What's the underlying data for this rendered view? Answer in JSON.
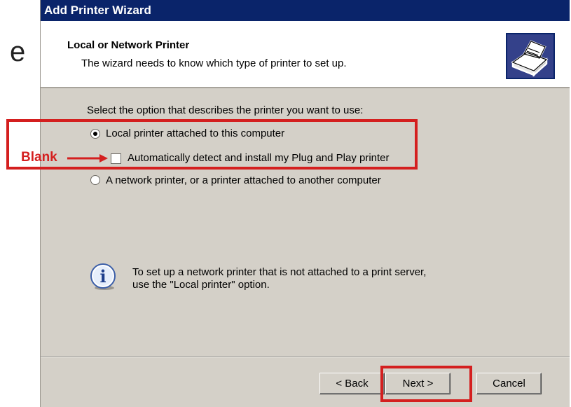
{
  "background_fragment": "e",
  "window": {
    "title": "Add Printer Wizard"
  },
  "header": {
    "title": "Local or Network Printer",
    "subtitle": "The wizard needs to know which type of printer to set up."
  },
  "content": {
    "prompt": "Select the option that describes the printer you want to use:",
    "options": [
      {
        "label": "Local printer attached to this computer",
        "selected": true
      },
      {
        "label": "A network printer, or a printer attached to another computer",
        "selected": false
      }
    ],
    "checkbox": {
      "label": "Automatically detect and install my Plug and Play printer",
      "checked": false
    },
    "info": "To set up a network printer that is not attached to a print server, use the \"Local printer\" option.",
    "info_line1": "To set up a network printer that is not attached to a print server,",
    "info_line2": "use the \"Local printer\" option."
  },
  "buttons": {
    "back": "< Back",
    "next": "Next >",
    "cancel": "Cancel"
  },
  "annotation": {
    "label": "Blank",
    "color": "#d41f1f"
  },
  "colors": {
    "titlebar": "#0a246a",
    "dialog": "#d4d0c8",
    "highlight": "#d41f1f"
  }
}
